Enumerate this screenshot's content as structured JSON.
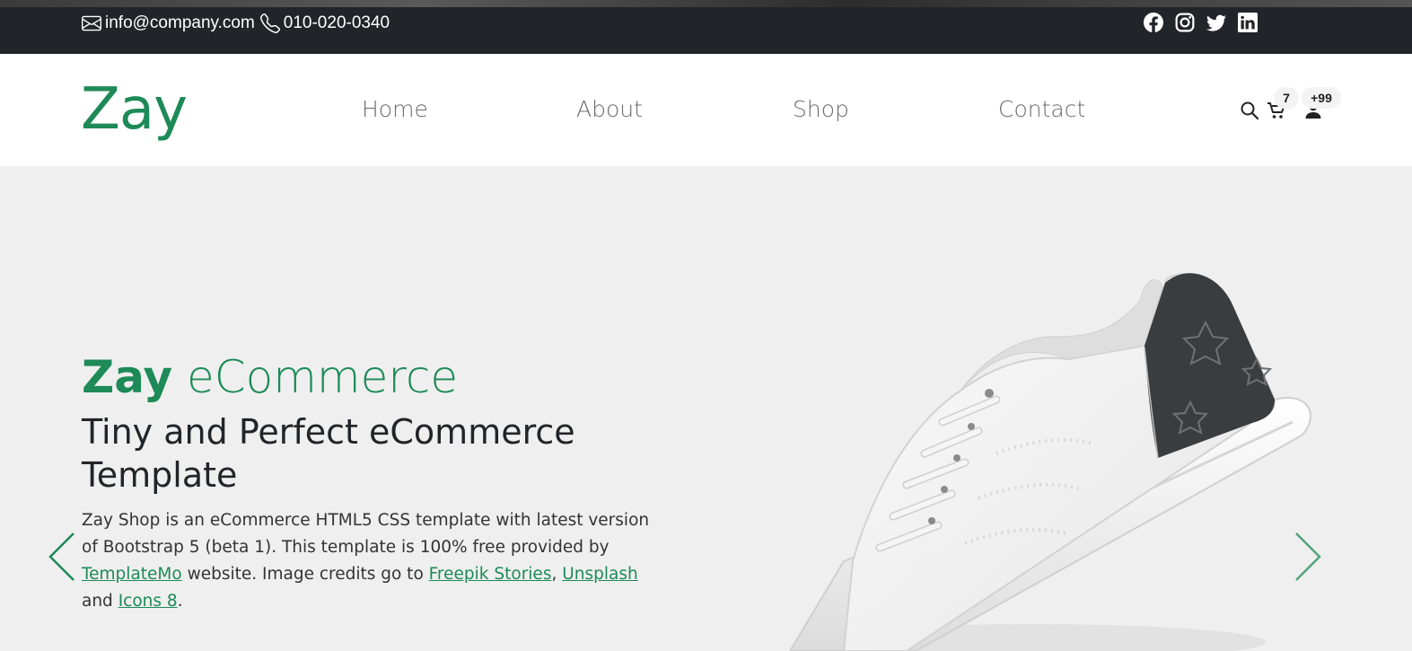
{
  "topbar": {
    "email": "info@company.com",
    "phone": "010-020-0340",
    "social_icons": [
      "facebook-icon",
      "instagram-icon",
      "twitter-icon",
      "linkedin-icon"
    ]
  },
  "navbar": {
    "logo": "Zay",
    "links": [
      "Home",
      "About",
      "Shop",
      "Contact"
    ],
    "cart_count": "7",
    "user_count": "+99"
  },
  "hero": {
    "title_bold": "Zay",
    "title_rest": " eCommerce",
    "subtitle": "Tiny and Perfect eCommerce Template",
    "desc_1": "Zay Shop is an eCommerce HTML5 CSS template with latest version of Bootstrap 5 (beta 1). This template is 100% free provided by ",
    "link_templatemo": "TemplateMo",
    "desc_2": " website. Image credits go to ",
    "link_freepik": "Freepik Stories",
    "desc_3": ", ",
    "link_unsplash": "Unsplash",
    "desc_4": " and ",
    "link_icons8": "Icons 8",
    "desc_5": "."
  },
  "colors": {
    "brand_green": "#1d8a57",
    "topbar_bg": "#212529",
    "hero_bg": "#efefef"
  }
}
